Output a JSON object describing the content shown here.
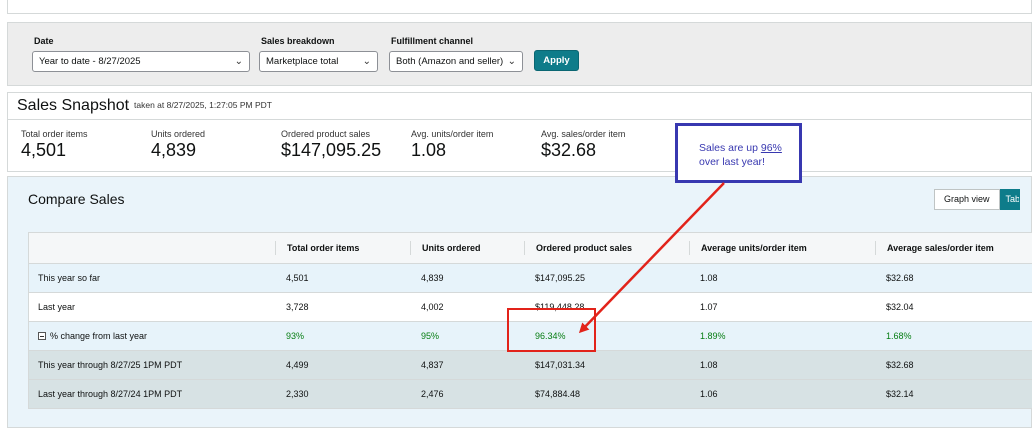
{
  "filters": {
    "date": {
      "label": "Date",
      "value": "Year to date - 8/27/2025"
    },
    "breakdown": {
      "label": "Sales breakdown",
      "value": "Marketplace total"
    },
    "channel": {
      "label": "Fulfillment channel",
      "value": "Both (Amazon and seller)"
    },
    "apply_label": "Apply"
  },
  "snapshot": {
    "title": "Sales Snapshot",
    "taken_at": "taken at 8/27/2025, 1:27:05 PM PDT",
    "metrics": [
      {
        "label": "Total order items",
        "value": "4,501"
      },
      {
        "label": "Units ordered",
        "value": "4,839"
      },
      {
        "label": "Ordered product sales",
        "value": "$147,095.25"
      },
      {
        "label": "Avg. units/order item",
        "value": "1.08"
      },
      {
        "label": "Avg. sales/order item",
        "value": "$32.68"
      }
    ]
  },
  "callout": {
    "prefix": "Sales are up ",
    "highlight": "96%",
    "suffix": "over last year!"
  },
  "compare": {
    "title": "Compare Sales",
    "view_graph": "Graph view",
    "view_table": "Table view",
    "columns": [
      "Total order items",
      "Units ordered",
      "Ordered product sales",
      "Average units/order item",
      "Average sales/order item"
    ],
    "rows": [
      {
        "label": "This year so far",
        "cells": [
          "4,501",
          "4,839",
          "$147,095.25",
          "1.08",
          "$32.68"
        ]
      },
      {
        "label": "Last year",
        "cells": [
          "3,728",
          "4,002",
          "$119,448.28",
          "1.07",
          "$32.04"
        ]
      },
      {
        "label": "% change from last year",
        "cells": [
          "93%",
          "95%",
          "96.34%",
          "1.89%",
          "1.68%"
        ]
      },
      {
        "label": "This year through 8/27/25 1PM PDT",
        "cells": [
          "4,499",
          "4,837",
          "$147,031.34",
          "1.08",
          "$32.68"
        ]
      },
      {
        "label": "Last year through 8/27/24 1PM PDT",
        "cells": [
          "2,330",
          "2,476",
          "$74,884.48",
          "1.06",
          "$32.14"
        ]
      }
    ]
  },
  "colors": {
    "accent": "#0e7c8a",
    "callout": "#3838b0",
    "annotation": "#e2231a",
    "positive": "#067d12"
  }
}
